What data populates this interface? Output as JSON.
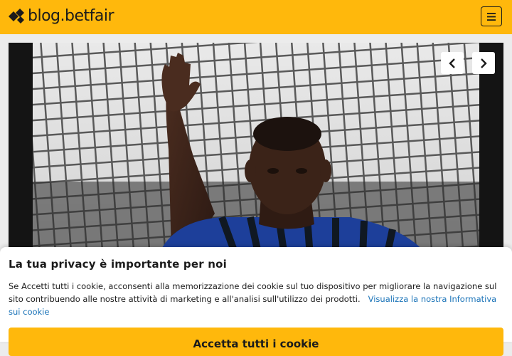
{
  "header": {
    "logo_text": "blog.betfair",
    "logo_icon": "betfair-diamond-icon",
    "menu_icon": "hamburger-menu-icon",
    "brand_color": "#ffb80c"
  },
  "carousel": {
    "prev_icon": "chevron-left-icon",
    "next_icon": "chevron-right-icon"
  },
  "cookie_banner": {
    "title": "La tua privacy è importante per noi",
    "body": "Se Accetti tutti i cookie, acconsenti alla memorizzazione dei cookie sul tuo dispositivo per migliorare la navigazione sul sito contribuendo alle nostre attività di marketing e all'analisi sull'utilizzo dei prodotti.",
    "link": "Visualizza la nostra Informativa sui cookie",
    "accept_button": "Accetta tutti i cookie",
    "link_color": "#1a73b8"
  }
}
